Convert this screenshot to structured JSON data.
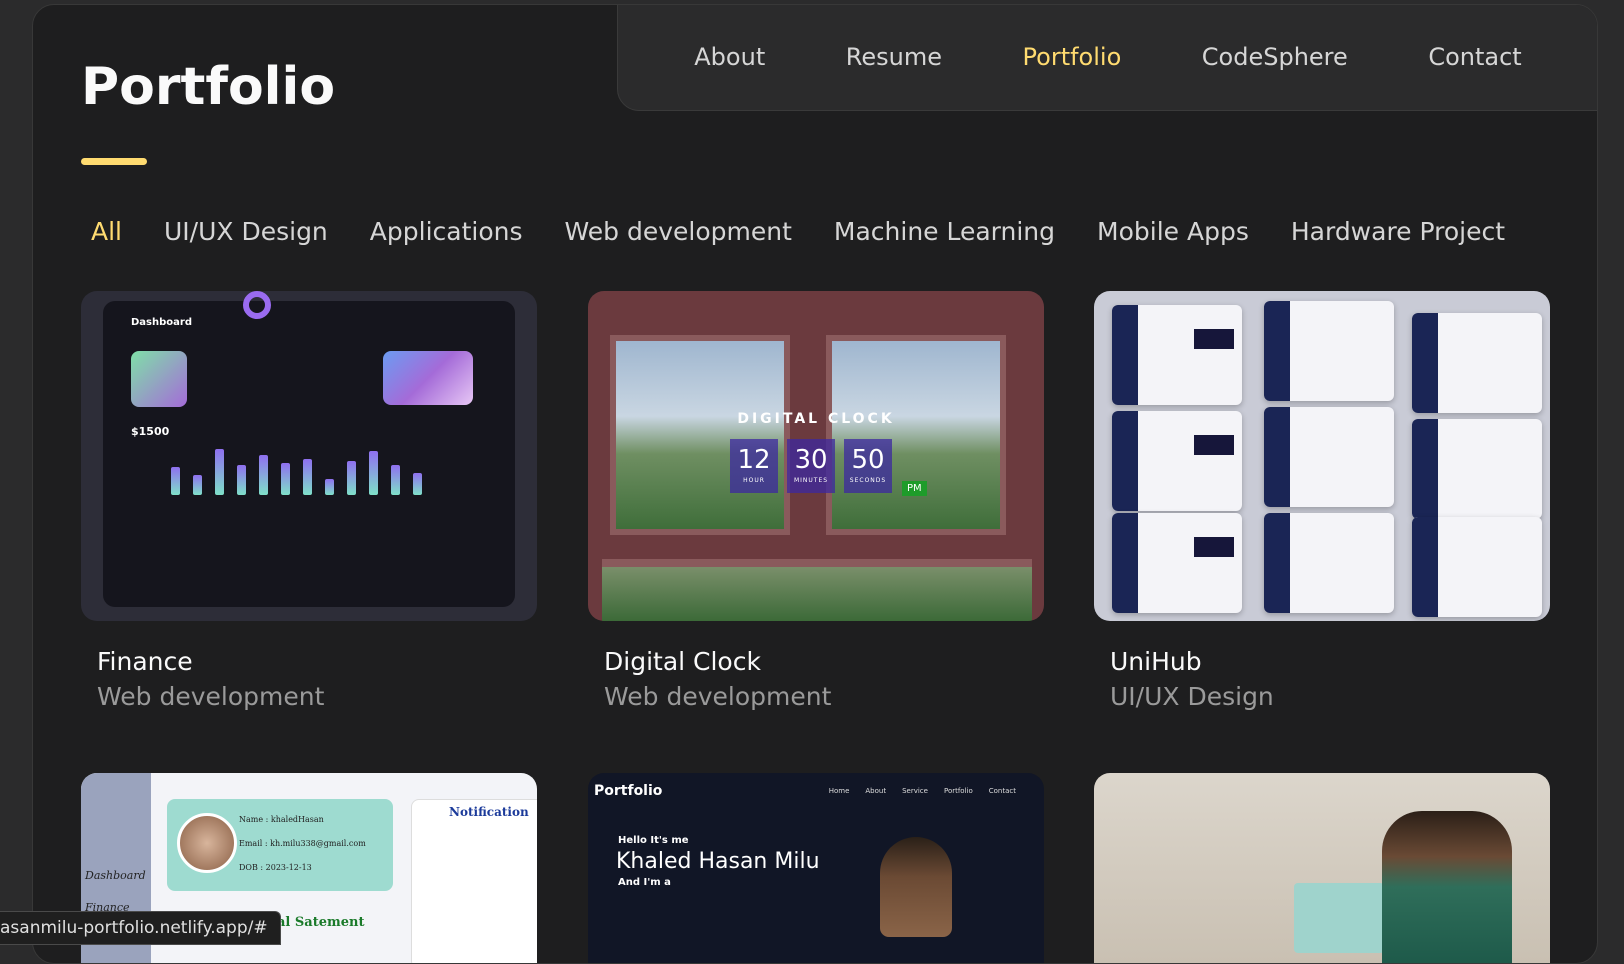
{
  "nav": {
    "items": [
      "About",
      "Resume",
      "Portfolio",
      "CodeSphere",
      "Contact"
    ],
    "active": "Portfolio"
  },
  "page": {
    "title": "Portfolio"
  },
  "filters": {
    "items": [
      "All",
      "UI/UX Design",
      "Applications",
      "Web development",
      "Machine Learning",
      "Mobile Apps",
      "Hardware Project"
    ],
    "active": "All"
  },
  "projects": [
    {
      "title": "Finance",
      "category": "Web development",
      "thumb": {
        "heading": "Dashboard",
        "balance": "$1500"
      }
    },
    {
      "title": "Digital Clock",
      "category": "Web development",
      "thumb": {
        "heading": "DIGITAL CLOCK",
        "hour": "12",
        "minutes": "30",
        "seconds": "50",
        "hour_label": "HOUR",
        "minutes_label": "MINUTES",
        "seconds_label": "SECONDS",
        "ampm": "PM"
      }
    },
    {
      "title": "UniHub",
      "category": "UI/UX Design"
    },
    {
      "thumb": {
        "name": "Name : khaledHasan",
        "email": "Email : kh.milu338@gmail.com",
        "dob": "DOB : 2023-12-13",
        "notification": "Notification",
        "dashboard": "Dashboard",
        "finance": "Finance",
        "statement": "al Satement"
      }
    },
    {
      "thumb": {
        "logo": "Portfolio",
        "nav": [
          "Home",
          "About",
          "Service",
          "Portfolio",
          "Contact"
        ],
        "hello": "Hello It's me",
        "name": "Khaled Hasan Milu",
        "role": "And I'm a"
      }
    },
    {}
  ],
  "status_bar": {
    "url": "asanmilu-portfolio.netlify.app/#"
  },
  "colors": {
    "accent": "#ffdb70",
    "panel": "#1e1e1f",
    "background": "#2b2b2c"
  }
}
